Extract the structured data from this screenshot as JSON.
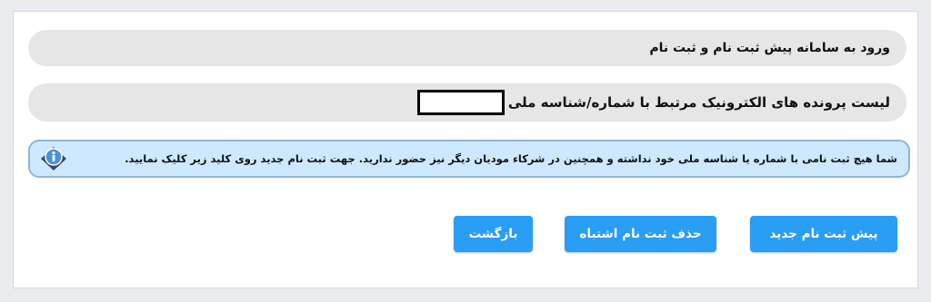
{
  "header": {
    "title": "ورود به سامانه پیش ثبت نام و ثبت نام"
  },
  "list": {
    "label": "لیست پرونده های الکترونیک مرتبط با شماره/شناسه ملی"
  },
  "info": {
    "message": "شما هیچ ثبت نامی با شماره یا شناسه ملی خود نداشته و همچنین در شرکاء مودیان دیگر نیز حضور ندارید. جهت ثبت نام جدید روی کلید زیر کلیک نمایید.",
    "icon": "info-icon"
  },
  "actions": {
    "new_label": "پیش ثبت نام جدید",
    "delete_label": "حذف ثبت نام اشتباه",
    "back_label": "بازگشت"
  },
  "colors": {
    "button": "#2a9df4",
    "info_background": "#cde8ff",
    "bar_background": "#e6e6e6"
  }
}
